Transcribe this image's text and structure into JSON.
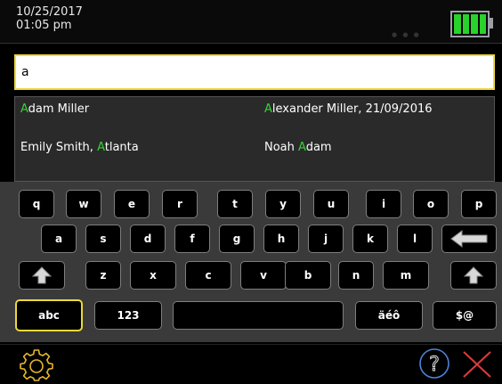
{
  "status": {
    "date": "10/25/2017",
    "time": "01:05 pm"
  },
  "battery": {
    "level_fraction": 1.0,
    "color": "#29d22b"
  },
  "search": {
    "value": "a",
    "border_color": "#ecd93a"
  },
  "results": [
    {
      "pre": "",
      "hl": "A",
      "post": "dam Miller"
    },
    {
      "pre": "",
      "hl": "A",
      "post": "lexander Miller, 21/09/2016"
    },
    {
      "pre": "Emily Smith, ",
      "hl": "A",
      "post": "tlanta"
    },
    {
      "pre": "Noah ",
      "hl": "A",
      "post": "dam"
    }
  ],
  "keyboard": {
    "row1": [
      "q",
      "w",
      "e",
      "r",
      "t",
      "y",
      "u",
      "i",
      "o",
      "p"
    ],
    "row2": [
      "a",
      "s",
      "d",
      "f",
      "g",
      "h",
      "j",
      "k",
      "l"
    ],
    "row3": [
      "z",
      "x",
      "c",
      "v",
      "b",
      "n",
      "m"
    ],
    "mode_abc": "abc",
    "mode_123": "123",
    "mode_accents": "äéô",
    "mode_symbols": "$@",
    "space": "",
    "backspace_icon": "backspace-arrow-icon",
    "shift_icon": "shift-arrow-icon"
  },
  "bottom": {
    "settings_icon": "gear-icon",
    "help_icon": "question-mark-icon",
    "close_icon": "close-x-icon",
    "close_color": "#d93a3a"
  }
}
